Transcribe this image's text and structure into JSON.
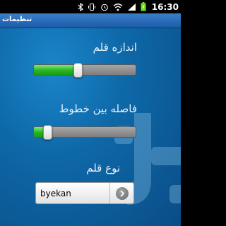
{
  "status_bar": {
    "time": "16:30",
    "icons": [
      "bluetooth-icon",
      "vibrate-icon",
      "alarm-icon",
      "wifi-icon",
      "signal-icon",
      "battery-charging-icon"
    ]
  },
  "title_bar": {
    "title": "تنظیمات"
  },
  "settings": {
    "font_size": {
      "label": "اندازه قلم",
      "value_percent": 43
    },
    "line_spacing": {
      "label": "فاصله بین خطوط",
      "value_percent": 13
    },
    "font_type": {
      "label": "نوع قلم",
      "selected": "byekan"
    }
  },
  "colors": {
    "accent_green": "#26b51f",
    "title_bar_blue": "#2a6db8",
    "background_blue": "#0e68a8"
  }
}
